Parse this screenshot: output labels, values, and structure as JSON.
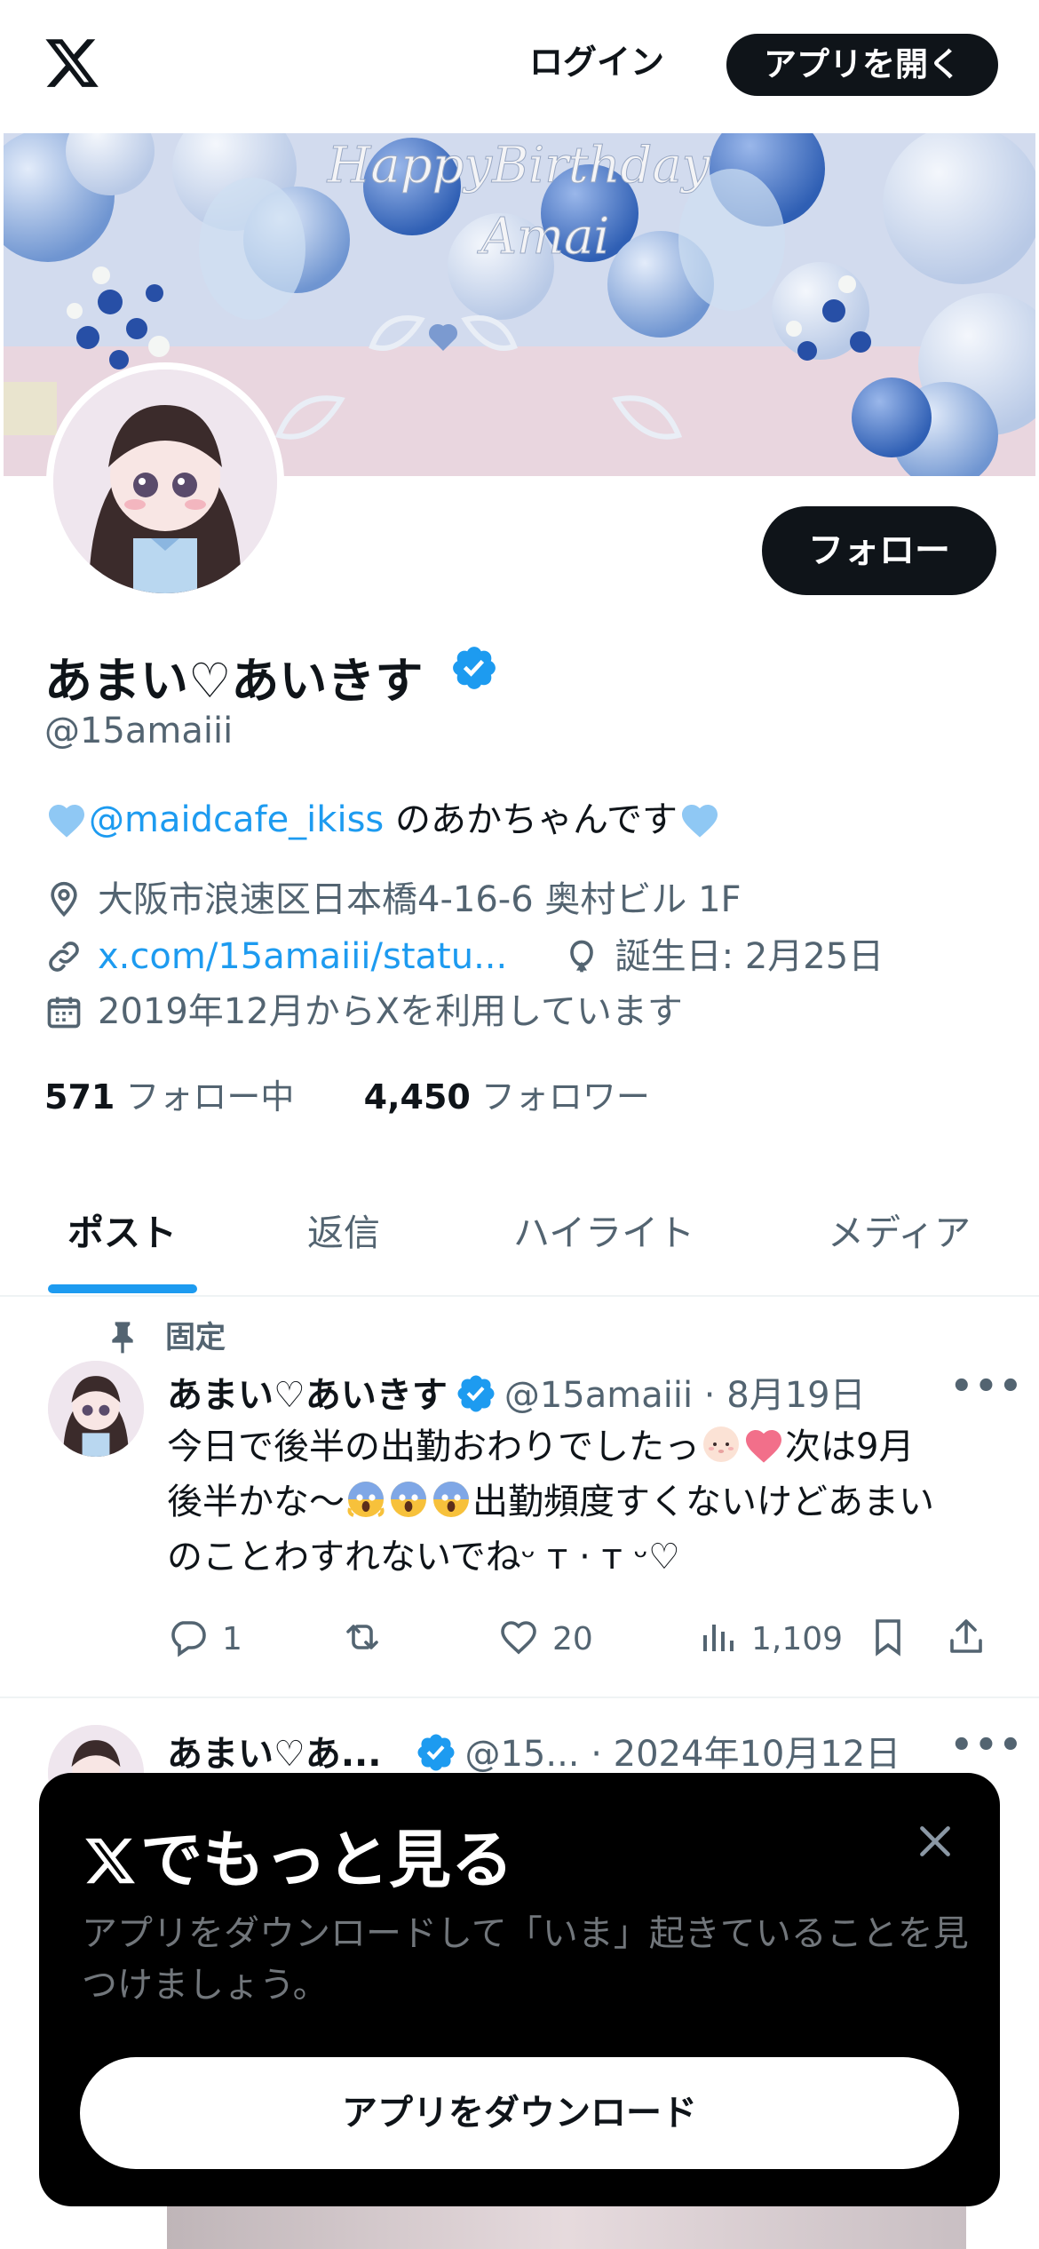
{
  "topbar": {
    "login": "ログイン",
    "open_app": "アプリを開く"
  },
  "banner": {
    "title": "HappyBirthday",
    "subtitle": "Amai"
  },
  "profile": {
    "follow": "フォロー",
    "name": "あまい♡あいきす",
    "handle": "@15amaiii",
    "bio_link": "@maidcafe_ikiss",
    "bio_text": " のあかちゃんです",
    "location": "大阪市浪速区日本橋4-16-6 奥村ビル 1F",
    "url": "x.com/15amaiii/statu...",
    "birthday": "誕生日: 2月25日",
    "joined": "2019年12月からXを利用しています",
    "following_count": "571",
    "following_label": "フォロー中",
    "followers_count": "4,450",
    "followers_label": "フォロワー"
  },
  "tabs": [
    "ポスト",
    "返信",
    "ハイライト",
    "メディア"
  ],
  "pinned_post": {
    "pinned_label": "固定",
    "name": "あまい♡あいきす",
    "handle": "@15amaiii",
    "date": "8月19日",
    "line1a": "今日で後半の出勤おわりでしたっ",
    "line1b": "次は9月",
    "line2a": "後半かな〜",
    "line2b": "出勤頻度すくないけどあまい",
    "line3": "のことわすれないでねᵕ ᴛ · ᴛ ᵕ♡",
    "replies": "1",
    "likes": "20",
    "views": "1,109"
  },
  "second_post": {
    "name": "あまい♡あ...",
    "handle": "@15...",
    "date": "2024年10月12日"
  },
  "sheet": {
    "title": "でもっと見る",
    "description": "アプリをダウンロードして「いま」起きていることを見つけましょう。",
    "button": "アプリをダウンロード"
  },
  "colors": {
    "accent": "#1d9bf0",
    "text": "#0f1419",
    "muted": "#536471"
  }
}
